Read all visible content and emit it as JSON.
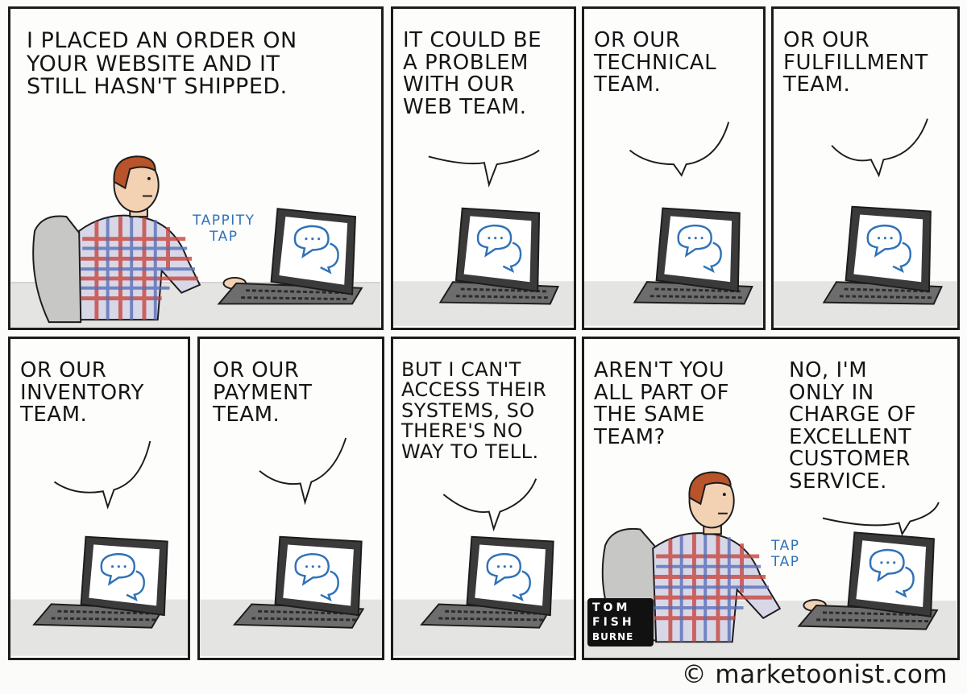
{
  "panels": [
    {
      "caption": "I PLACED AN ORDER ON\nYOUR WEBSITE AND IT\nSTILL HASN'T SHIPPED.",
      "sfx": "TAPPITY\nTAP"
    },
    {
      "caption": "IT COULD BE\nA PROBLEM\nWITH OUR\nWEB TEAM."
    },
    {
      "caption": "OR OUR\nTECHNICAL\nTEAM."
    },
    {
      "caption": "OR OUR\nFULFILLMENT\nTEAM."
    },
    {
      "caption": "OR OUR\nINVENTORY\nTEAM."
    },
    {
      "caption": "OR OUR\nPAYMENT\nTEAM."
    },
    {
      "caption": "BUT I CAN'T\nACCESS THEIR\nSYSTEMS, SO\nTHERE'S NO\nWAY TO TELL."
    },
    {
      "caption": "AREN'T YOU\nALL PART OF\nTHE SAME\nTEAM?",
      "reply": "NO, I'M\nONLY IN\nCHARGE OF\nEXCELLENT\nCUSTOMER\nSERVICE.",
      "sfx": "TAP\nTAP"
    }
  ],
  "signature": {
    "line1": "TOM",
    "line2": "FISH",
    "line3": "BURNE"
  },
  "credit": "© marketoonist.com",
  "colors": {
    "ink": "#1c1c1c",
    "chat_blue": "#2f72b8",
    "plaid_red": "#c8453f",
    "plaid_blue": "#5a6fb8",
    "skin": "#f3d1b3",
    "hair": "#b8532a",
    "desk": "#e4e4e2",
    "laptop": "#3a3a3a"
  }
}
